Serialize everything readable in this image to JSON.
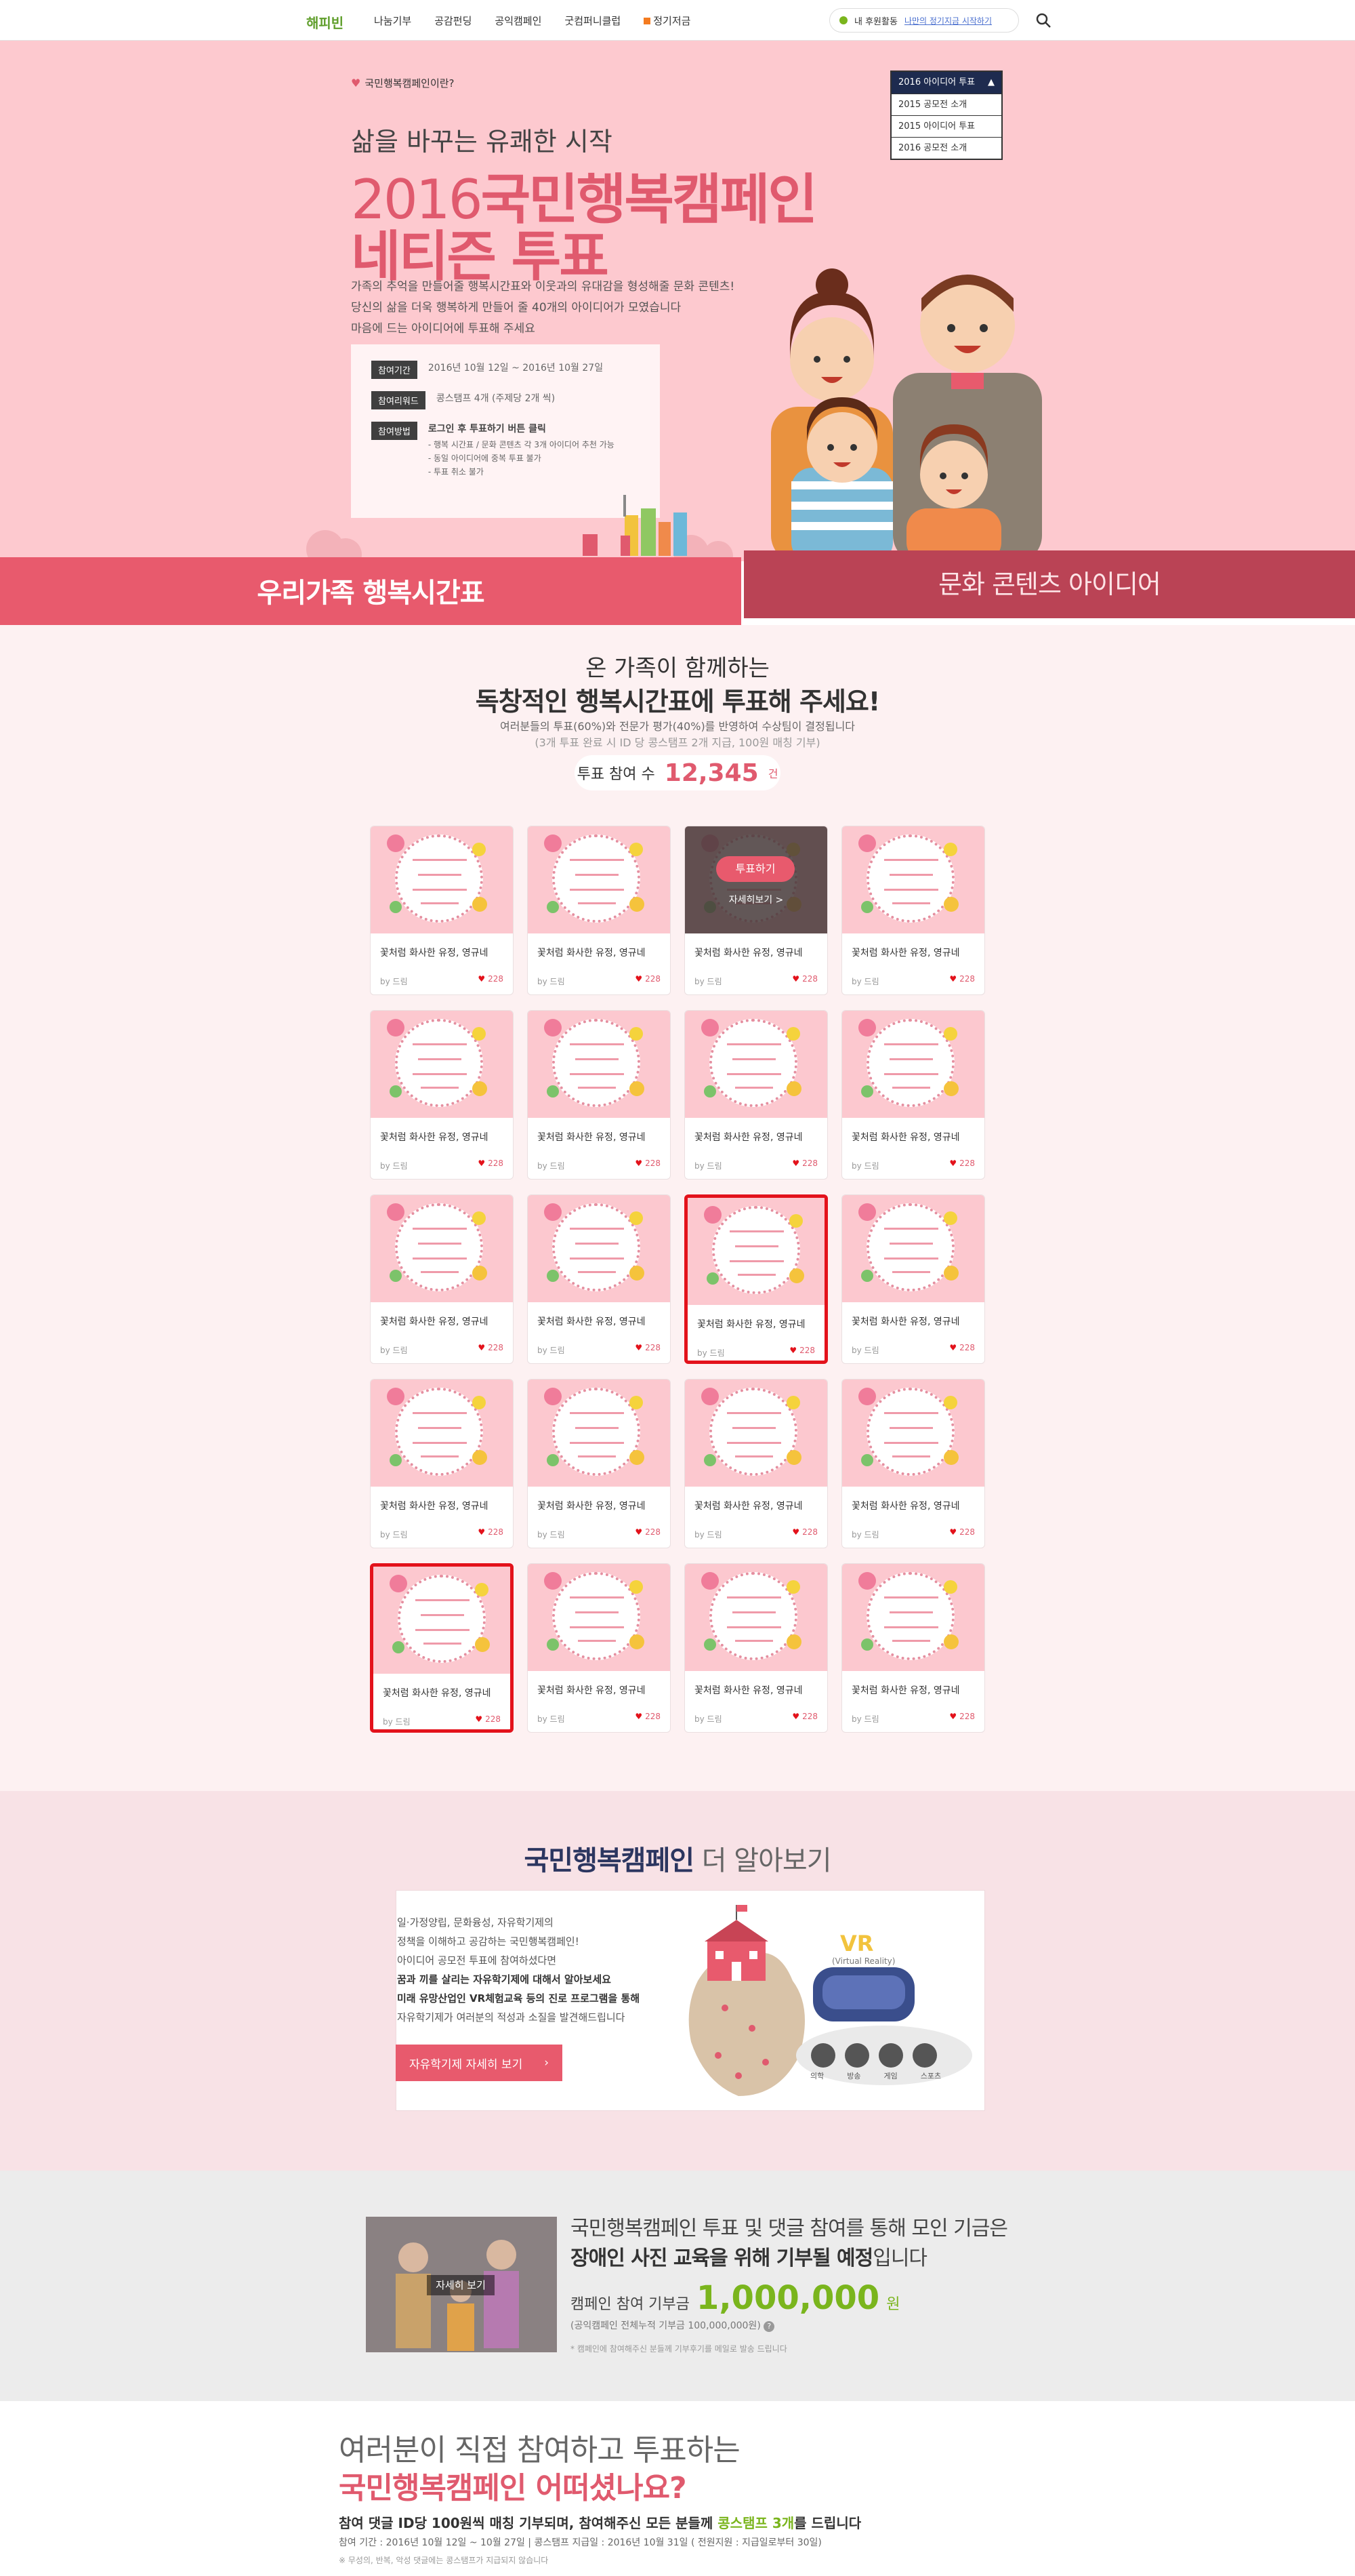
{
  "nav": {
    "logo": "해피빈",
    "items": [
      "나눔기부",
      "공감펀딩",
      "공익캠페인",
      "굿컴퍼니클럽",
      "정기저금"
    ],
    "my_activity": "내 후원활동",
    "login_link": "나만의 정기지금 시작하기"
  },
  "hero": {
    "tag": "국민행복캠페인이란?",
    "subtitle": "삶을 바꾸는 유쾌한 시작",
    "title_year": "2016",
    "title_main": "국민행복캠페인",
    "title_line2": "네티즌 투표",
    "desc": [
      "가족의 추억을 만들어줄 행복시간표와 이웃과의 유대감을 형성해줄 문화 콘텐츠!",
      "당신의 삶을 더욱 행복하게 만들어 줄 40개의 아이디어가 모였습니다",
      "마음에 드는 아이디어에 투표해 주세요"
    ],
    "info": {
      "period_label": "참여기간",
      "period_value": "2016년 10월 12일 ~ 2016년 10월 27일",
      "reward_label": "참여리워드",
      "reward_value": "콩스탬프 4개 (주제당 2개 씩)",
      "method_label": "참여방법",
      "method_value": "로그인 후 투표하기 버튼 클릭",
      "method_notes": [
        "- 행복 시간표 / 문화 콘텐츠 각 3개 아이디어 추천 가능",
        "- 동일 아이디어에 중복 투표 불가",
        "- 투표 취소 불가"
      ]
    },
    "dropdown": {
      "selected": "2016 아이디어 투표",
      "options": [
        "2015 공모전 소개",
        "2015 아이디어 투표",
        "2016 공모전 소개"
      ]
    }
  },
  "tabs": {
    "active": "우리가족 행복시간표",
    "inactive": "문화 콘텐츠 아이디어"
  },
  "vote": {
    "heading1": "온 가족이 함께하는",
    "heading2": "독창적인 행복시간표에 투표해 주세요!",
    "note1": "여러분들의 투표(60%)와 전문가 평가(40%)를 반영하여 수상팀이 결정됩니다",
    "note2": "(3개 투표 완료 시 ID 당 콩스탬프 2개 지급, 100원 매칭 기부)",
    "counter_label": "투표 참여 수",
    "counter_value": "12,345",
    "counter_unit": "건",
    "overlay_vote": "투표하기",
    "overlay_detail": "자세히보기 >",
    "cards": [
      {
        "title": "꽃처럼 화사한 유정, 영규네",
        "by": "by 드림",
        "likes": "228"
      },
      {
        "title": "꽃처럼 화사한 유정, 영규네",
        "by": "by 드림",
        "likes": "228"
      },
      {
        "title": "꽃처럼 화사한 유정, 영규네",
        "by": "by 드림",
        "likes": "228"
      },
      {
        "title": "꽃처럼 화사한 유정, 영규네",
        "by": "by 드림",
        "likes": "228"
      },
      {
        "title": "꽃처럼 화사한 유정, 영규네",
        "by": "by 드림",
        "likes": "228"
      },
      {
        "title": "꽃처럼 화사한 유정, 영규네",
        "by": "by 드림",
        "likes": "228"
      },
      {
        "title": "꽃처럼 화사한 유정, 영규네",
        "by": "by 드림",
        "likes": "228"
      },
      {
        "title": "꽃처럼 화사한 유정, 영규네",
        "by": "by 드림",
        "likes": "228"
      },
      {
        "title": "꽃처럼 화사한 유정, 영규네",
        "by": "by 드림",
        "likes": "228"
      },
      {
        "title": "꽃처럼 화사한 유정, 영규네",
        "by": "by 드림",
        "likes": "228"
      },
      {
        "title": "꽃처럼 화사한 유정, 영규네",
        "by": "by 드림",
        "likes": "228"
      },
      {
        "title": "꽃처럼 화사한 유정, 영규네",
        "by": "by 드림",
        "likes": "228"
      },
      {
        "title": "꽃처럼 화사한 유정, 영규네",
        "by": "by 드림",
        "likes": "228"
      },
      {
        "title": "꽃처럼 화사한 유정, 영규네",
        "by": "by 드림",
        "likes": "228"
      },
      {
        "title": "꽃처럼 화사한 유정, 영규네",
        "by": "by 드림",
        "likes": "228"
      },
      {
        "title": "꽃처럼 화사한 유정, 영규네",
        "by": "by 드림",
        "likes": "228"
      },
      {
        "title": "꽃처럼 화사한 유정, 영규네",
        "by": "by 드림",
        "likes": "228"
      },
      {
        "title": "꽃처럼 화사한 유정, 영규네",
        "by": "by 드림",
        "likes": "228"
      },
      {
        "title": "꽃처럼 화사한 유정, 영규네",
        "by": "by 드림",
        "likes": "228"
      },
      {
        "title": "꽃처럼 화사한 유정, 영규네",
        "by": "by 드림",
        "likes": "228"
      }
    ]
  },
  "more": {
    "title_bold": "국민행복캠페인",
    "title_light": " 더 알아보기",
    "lines": [
      "일·가정양립, 문화융성, 자유학기제의",
      "정책을 이해하고 공감하는 국민행복캠페인!",
      "아이디어 공모전 투표에 참여하셨다면",
      "꿈과 끼를 살리는 자유학기제에 대해서 알아보세요",
      "미래 유망산업인 VR체험교육 등의 진로 프로그램을 통해",
      "자유학기제가 여러분의 적성과 소질을 발견해드립니다"
    ],
    "button": "자유학기제 자세히 보기",
    "vr_label": "VR",
    "vr_sub": "(Virtual Reality)",
    "icons": [
      "의학",
      "방송",
      "게임",
      "스포츠"
    ]
  },
  "donate": {
    "photo_button": "자세히 보기",
    "line1": "국민행복캠페인 투표 및 댓글 참여를 통해 모인 기금은",
    "line2_bold": "장애인 사진 교육을 위해 기부될 예정",
    "line2_end": "입니다",
    "amount_label": "캠페인 참여 기부금",
    "amount": "1,000,000",
    "amount_unit": "원",
    "total": "(공익캠페인 전체누적 기부금 100,000,000원)",
    "note": "* 캠페인에 참여해주신 분들께 기부후기를 메일로 발송 드립니다"
  },
  "survey": {
    "line1": "여러분이 직접 참여하고 투표하는",
    "line2": "국민행복캠페인 어떠셨나요?",
    "line3_a": "참여 댓글 ID당 100원씩 매칭 기부되며, 참여해주신 모든 분들께 ",
    "line3_b": "콩스탬프 3개",
    "line3_c": "를 드립니다",
    "line4": "참여 기간 : 2016년 10월 12일 ~ 10월 27일  |  콩스탬프 지급일 : 2016년 10월 31일 ( 전원지원 : 지급일로부터 30일)",
    "line5": "※ 무성의, 반복, 악성 댓글에는 콩스탬프가 지급되지 않습니다"
  },
  "colors": {
    "accent": "#e85a6d",
    "accent_dark": "#ba4355",
    "hero_bg": "#fdc9cf",
    "green": "#7ab51d",
    "highlight": "#e3121b"
  }
}
